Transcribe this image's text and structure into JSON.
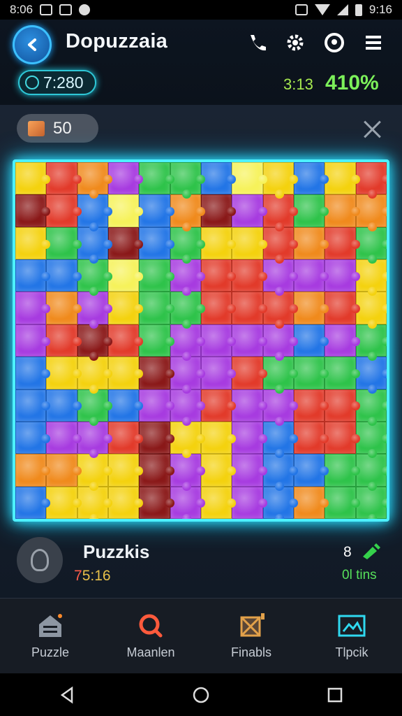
{
  "status_bar": {
    "time_left": "8:06",
    "time_right": "9:16"
  },
  "header": {
    "title": "Dopuzzaia",
    "timer": "7:280",
    "elapsed": "3:13",
    "progress_label": "410%",
    "icons": [
      "phone-icon",
      "gear-icon",
      "help-icon",
      "menu-icon"
    ]
  },
  "main": {
    "coins": "50",
    "player": {
      "name": "Puzzkis",
      "time_first": "7",
      "time_rest": "5:16",
      "moves": "8",
      "moves_label": "0l tins"
    }
  },
  "board": {
    "rows": 11,
    "cols": 12,
    "palette": {
      "Y": "#f4d20e",
      "R": "#e23a2a",
      "P": "#a73be0",
      "G": "#2ec34a",
      "B": "#2275e6",
      "O": "#f08a1c",
      "M": "#c22fc8",
      "D": "#8a1818",
      "C": "#25b9d8",
      "L": "#f6f25a"
    },
    "layout": [
      "YROPGGBLYBYR",
      "DRBLBODPRGOO",
      "YGBDBGYYRORG",
      "BBGLGPRRPPPY",
      "POPYGGRRRORY",
      "PRDRGPPPPBPG",
      "BYYYDPPRGGGB",
      "BBGBPPRPPRRG",
      "BPPRDYYPBRRG",
      "OOYYDPYPBBGG",
      "BYYYDPYPBOGG"
    ]
  },
  "bottom_nav": [
    {
      "label": "Puzzle",
      "icon": "home-puzzle-icon",
      "color": "#c9d0d8"
    },
    {
      "label": "Maanlen",
      "icon": "search-icon",
      "color": "#ff5a3c"
    },
    {
      "label": "Finabls",
      "icon": "trophy-icon",
      "color": "#e2a14a"
    },
    {
      "label": "Tlpcik",
      "icon": "gallery-icon",
      "color": "#2fd9f0"
    }
  ]
}
